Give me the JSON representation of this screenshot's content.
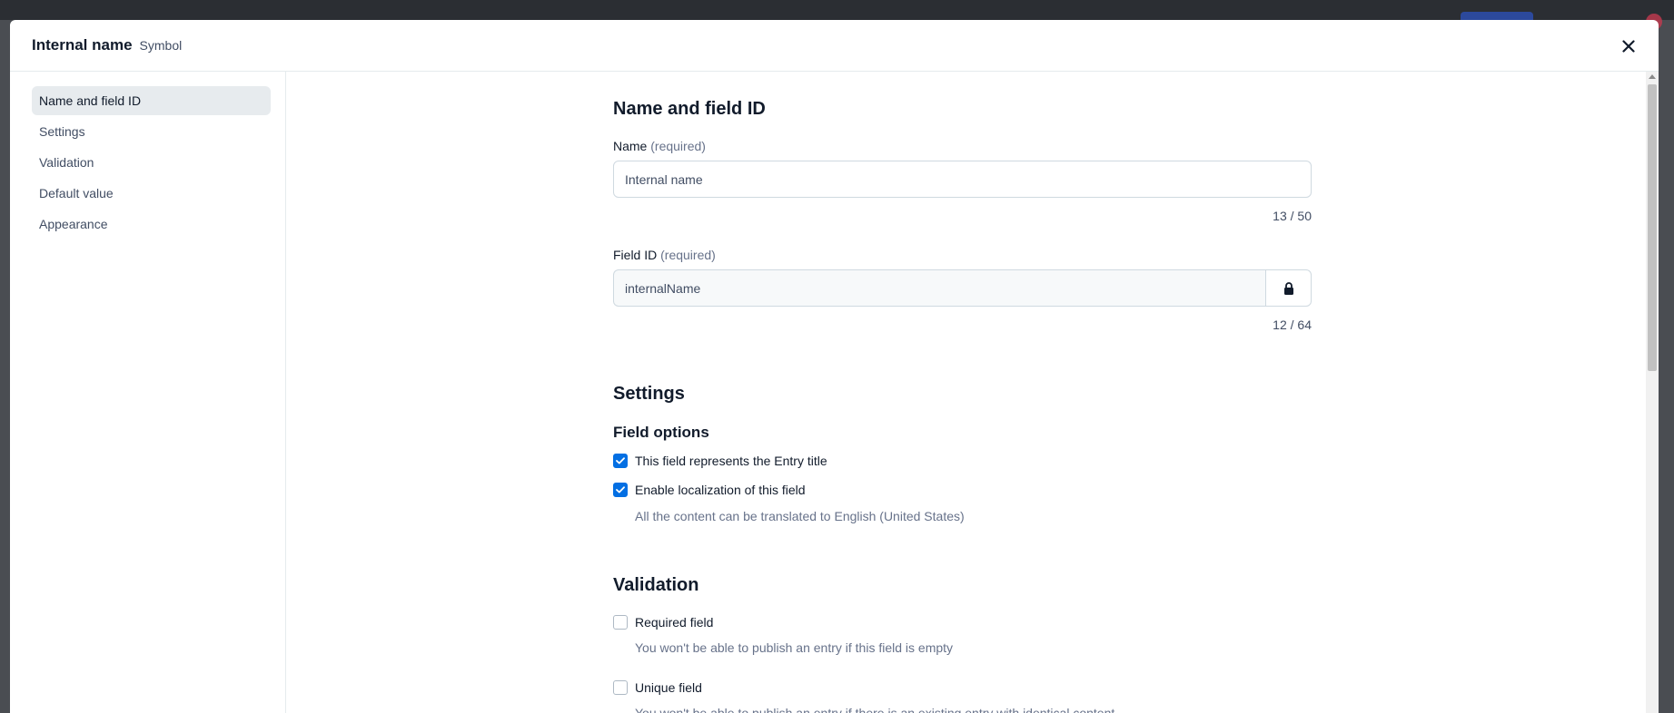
{
  "modal": {
    "title": "Internal name",
    "subtitle": "Symbol"
  },
  "sidebar": {
    "items": [
      {
        "label": "Name and field ID",
        "active": true
      },
      {
        "label": "Settings",
        "active": false
      },
      {
        "label": "Validation",
        "active": false
      },
      {
        "label": "Default value",
        "active": false
      },
      {
        "label": "Appearance",
        "active": false
      }
    ]
  },
  "name_section": {
    "heading": "Name and field ID",
    "name_label": "Name",
    "name_required": "(required)",
    "name_value": "Internal name",
    "name_counter": "13 / 50",
    "field_id_label": "Field ID",
    "field_id_required": "(required)",
    "field_id_value": "internalName",
    "field_id_counter": "12 / 64",
    "lock_icon": "lock-icon"
  },
  "settings_section": {
    "heading": "Settings",
    "field_options_heading": "Field options",
    "options": [
      {
        "label": "This field represents the Entry title",
        "checked": true
      },
      {
        "label": "Enable localization of this field",
        "checked": true
      }
    ],
    "localization_help": "All the content can be translated to English (United States)"
  },
  "validation_section": {
    "heading": "Validation",
    "required_label": "Required field",
    "required_checked": false,
    "required_help": "You won't be able to publish an entry if this field is empty",
    "unique_label": "Unique field",
    "unique_checked": false,
    "unique_help": "You won't be able to publish an entry if there is an existing entry with identical content"
  },
  "colors": {
    "accent": "#036fe3",
    "text_primary": "#111b2b",
    "text_secondary": "#67728a",
    "sidebar_active_bg": "#e7ebee"
  }
}
